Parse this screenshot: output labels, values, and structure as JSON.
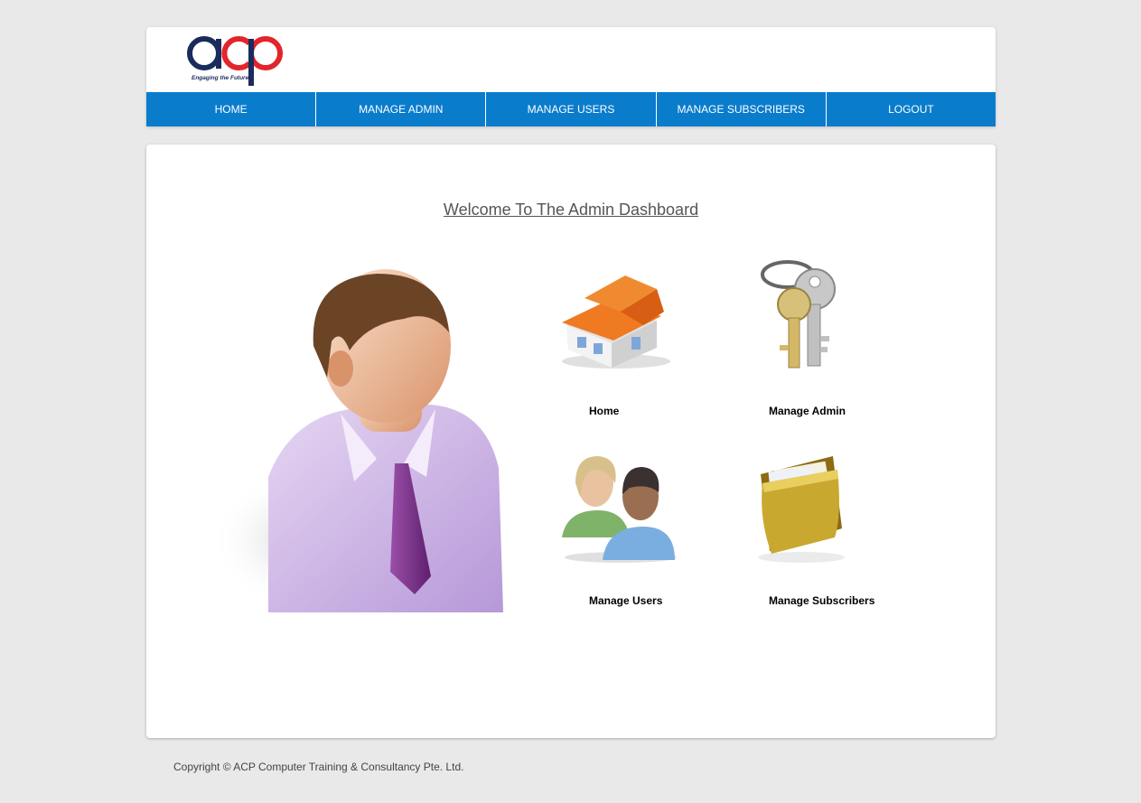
{
  "logo": {
    "text": "acp",
    "tagline": "Engaging the Future"
  },
  "nav": [
    {
      "label": "HOME"
    },
    {
      "label": "MANAGE ADMIN"
    },
    {
      "label": "MANAGE USERS"
    },
    {
      "label": "MANAGE SUBSCRIBERS"
    },
    {
      "label": "LOGOUT"
    }
  ],
  "main": {
    "welcome": "Welcome To The Admin Dashboard",
    "tiles": [
      {
        "label": "Home",
        "icon": "house-icon"
      },
      {
        "label": "Manage Admin",
        "icon": "keys-icon"
      },
      {
        "label": "Manage Users",
        "icon": "users-icon"
      },
      {
        "label": "Manage Subscribers",
        "icon": "folder-icon"
      }
    ]
  },
  "footer": {
    "copyright": "Copyright © ACP Computer Training & Consultancy Pte. Ltd."
  },
  "colors": {
    "nav_bg": "#0a7ccc",
    "page_bg": "#e9e9e9",
    "logo_navy": "#1a2b5c",
    "logo_red": "#e3242b"
  }
}
